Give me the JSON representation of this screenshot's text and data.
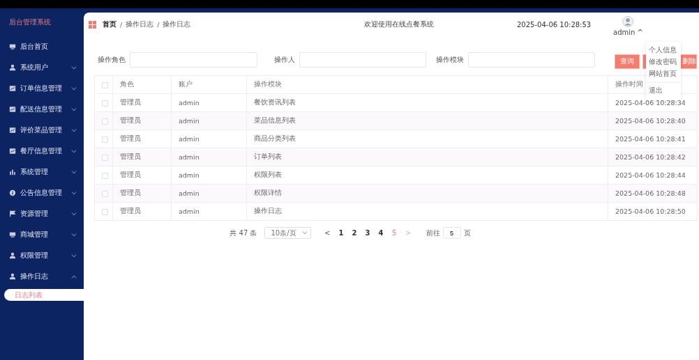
{
  "sidebar": {
    "title": "后台管理系统",
    "items": [
      {
        "label": "后台首页",
        "kind": "link"
      },
      {
        "label": "系统用户",
        "kind": "group",
        "expanded": false
      },
      {
        "label": "订单信息管理",
        "kind": "group",
        "expanded": false
      },
      {
        "label": "配送信息管理",
        "kind": "group",
        "expanded": false
      },
      {
        "label": "评价菜品管理",
        "kind": "group",
        "expanded": false
      },
      {
        "label": "餐厅信息管理",
        "kind": "group",
        "expanded": false
      },
      {
        "label": "系统管理",
        "kind": "group",
        "expanded": false
      },
      {
        "label": "公告信息管理",
        "kind": "group",
        "expanded": false
      },
      {
        "label": "资源管理",
        "kind": "group",
        "expanded": false
      },
      {
        "label": "商城管理",
        "kind": "group",
        "expanded": false
      },
      {
        "label": "权限管理",
        "kind": "group",
        "expanded": false
      },
      {
        "label": "操作日志",
        "kind": "group",
        "expanded": true,
        "children": [
          {
            "label": "日志列表",
            "selected": true
          }
        ]
      }
    ]
  },
  "header": {
    "breadcrumb": [
      "首页",
      "操作日志",
      "操作日志"
    ],
    "separator": "/",
    "welcome": "欢迎使用在线点餐系统",
    "datetime": "2025-04-06 10:28:53",
    "user": "admin",
    "user_caret": "^"
  },
  "user_menu": [
    {
      "label": "个人信息"
    },
    {
      "label": "修改密码"
    },
    {
      "label": "网站首页"
    },
    {
      "label": "退出"
    }
  ],
  "filters": [
    {
      "label": "操作角色"
    },
    {
      "label": "操作人"
    },
    {
      "label": "操作模块"
    }
  ],
  "buttons": [
    {
      "label": "查询"
    },
    {
      "label": "删除"
    }
  ],
  "table": {
    "all_checked": false,
    "columns": [
      "角色",
      "账户",
      "操作模块",
      "操作时间"
    ],
    "rows": [
      {
        "checked": false,
        "cells": [
          "管理员",
          "admin",
          "餐饮资讯列表",
          "2025-04-06 10:28:34"
        ]
      },
      {
        "checked": false,
        "cells": [
          "管理员",
          "admin",
          "菜品信息列表",
          "2025-04-06 10:28:40"
        ]
      },
      {
        "checked": false,
        "cells": [
          "管理员",
          "admin",
          "商品分类列表",
          "2025-04-06 10:28:41"
        ]
      },
      {
        "checked": false,
        "cells": [
          "管理员",
          "admin",
          "订单列表",
          "2025-04-06 10:28:42"
        ]
      },
      {
        "checked": false,
        "cells": [
          "管理员",
          "admin",
          "权限列表",
          "2025-04-06 10:28:44"
        ]
      },
      {
        "checked": false,
        "cells": [
          "管理员",
          "admin",
          "权限详情",
          "2025-04-06 10:28:48"
        ]
      },
      {
        "checked": false,
        "cells": [
          "管理员",
          "admin",
          "操作日志",
          "2025-04-06 10:28:50"
        ]
      }
    ]
  },
  "pagination": {
    "total": "共 47 条",
    "page_size": "10条/页",
    "prev": "<",
    "pages": [
      {
        "label": "1",
        "selected": false
      },
      {
        "label": "2",
        "selected": false
      },
      {
        "label": "3",
        "selected": false
      },
      {
        "label": "4",
        "selected": false
      },
      {
        "label": "5",
        "selected": true
      }
    ],
    "next": ">",
    "goto_label": "前往",
    "goto_value": "5",
    "goto_suffix": "页"
  }
}
